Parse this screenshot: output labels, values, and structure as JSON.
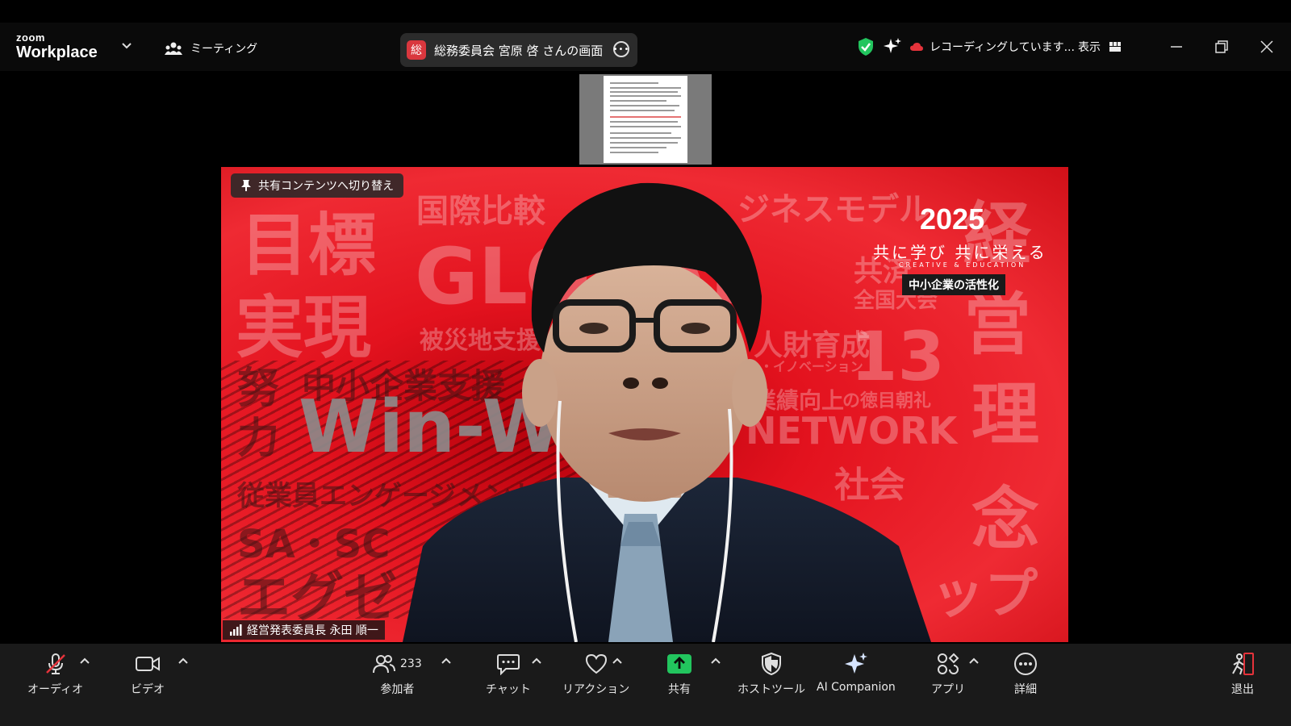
{
  "app": {
    "brand_small": "zoom",
    "brand_big": "Workplace"
  },
  "header": {
    "meeting_label": "ミーティング",
    "share_badge": "総",
    "share_title": "総務委員会 宮原 啓 さんの画面",
    "recording_text": "レコーディングしています...",
    "view_label": "表示"
  },
  "slide": {
    "year": "2025",
    "tagline": "共に学び 共に栄える",
    "tagline_sub": "CREATIVE & EDUCATION",
    "tag_box": "中小企業の活性化",
    "words": [
      "目標",
      "国際比較",
      "ジネスモデル",
      "経",
      "実現",
      "GLOBAL",
      "共済",
      "全国大会",
      "被災地支援",
      "人財育成",
      "13",
      "営",
      "努",
      "中小企業支援",
      "・イノベーション",
      "業績向上",
      "の徳目朝礼",
      "力",
      "Win-Win",
      "NETWORK",
      "理",
      "従業員エンゲージメント",
      "社会",
      "念",
      "SA・SC",
      "エグゼ",
      "ップ"
    ]
  },
  "video": {
    "switch_button": "共有コンテンツへ切り替え",
    "speaker_name": "経営発表委員長 永田 順一"
  },
  "toolbar": {
    "audio": "オーディオ",
    "video": "ビデオ",
    "participants": "参加者",
    "participants_count": "233",
    "chat": "チャット",
    "reaction": "リアクション",
    "share": "共有",
    "host_tools": "ホストツール",
    "ai_companion": "AI Companion",
    "apps": "アプリ",
    "more": "詳細",
    "leave": "退出"
  },
  "colors": {
    "accent_green": "#22c55e",
    "record_red": "#e5333b",
    "slide_red": "#e3121e",
    "badge_red": "#d9373e"
  }
}
